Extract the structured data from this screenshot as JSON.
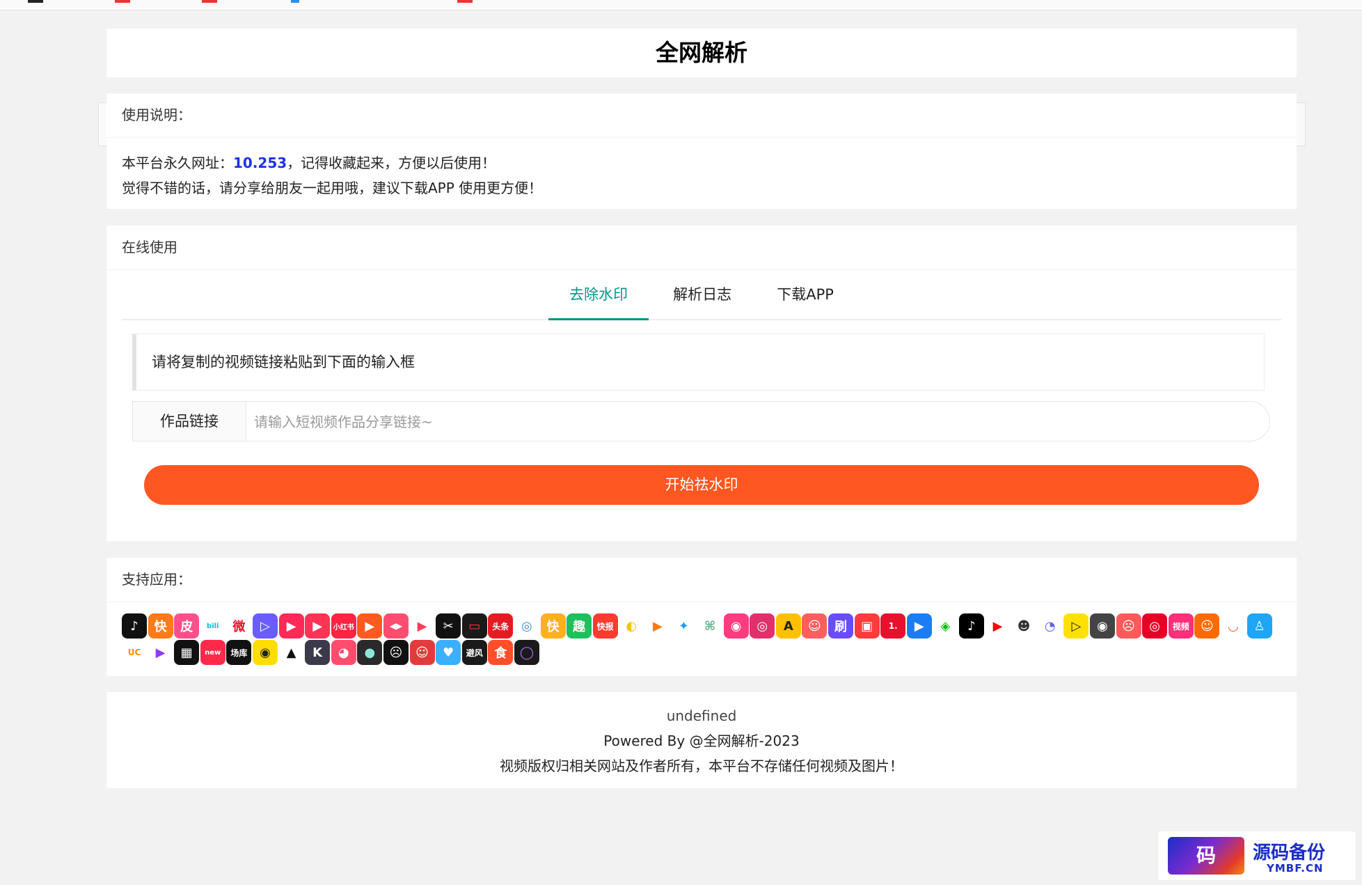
{
  "page": {
    "title": "全网解析"
  },
  "notice": {
    "heading": "使用说明：",
    "line1_prefix": "本平台永久网址：",
    "url": "10.253",
    "line1_suffix": "，记得收藏起来，方便以后使用！",
    "line2": "觉得不错的话，请分享给朋友一起用哦，建议下载APP 使用更方便！"
  },
  "online": {
    "heading": "在线使用",
    "tabs": [
      {
        "label": "去除水印",
        "active": true
      },
      {
        "label": "解析日志",
        "active": false
      },
      {
        "label": "下载APP",
        "active": false
      }
    ],
    "hint": "请将复制的视频链接粘贴到下面的输入框",
    "input_label": "作品链接",
    "input_placeholder": "请输入短视频作品分享链接~",
    "input_value": "",
    "submit_label": "开始祛水印"
  },
  "apps": {
    "heading": "支持应用：",
    "icons": [
      {
        "name": "douyin-icon",
        "text": "♪",
        "bg": "#111111"
      },
      {
        "name": "kuaishou-icon",
        "text": "快",
        "bg": "#ff7a18"
      },
      {
        "name": "pipixia-icon",
        "text": "皮",
        "bg": "#ff4f8b"
      },
      {
        "name": "bilibili-icon",
        "text": "bili",
        "bg": "#ffffff",
        "fg": "#23ade5"
      },
      {
        "name": "weibo-icon",
        "text": "微",
        "bg": "#ffffff",
        "fg": "#e6162d"
      },
      {
        "name": "player-icon",
        "text": "▷",
        "bg": "#6b5cff"
      },
      {
        "name": "live-icon",
        "text": "▶",
        "bg": "#ff2a55"
      },
      {
        "name": "video-icon",
        "text": "▶",
        "bg": "#ff3355"
      },
      {
        "name": "xiaohongshu-icon",
        "text": "小红书",
        "bg": "#ff2442"
      },
      {
        "name": "huoshan-icon",
        "text": "▶",
        "bg": "#ff5a1f"
      },
      {
        "name": "camera-icon",
        "text": "◀▶",
        "bg": "#ff4d6d"
      },
      {
        "name": "play-icon",
        "text": "▶",
        "bg": "#ffffff",
        "fg": "#ff3b5c"
      },
      {
        "name": "capcut-icon",
        "text": "✂",
        "bg": "#111111"
      },
      {
        "name": "xigua-icon",
        "text": "▭",
        "bg": "#1a1a1a",
        "fg": "#ff3b30"
      },
      {
        "name": "toutiao-icon",
        "text": "头条",
        "bg": "#e51b23"
      },
      {
        "name": "lens-icon",
        "text": "◎",
        "bg": "#ffffff",
        "fg": "#3a8ee6"
      },
      {
        "name": "kuai-icon",
        "text": "快",
        "bg": "#ffb020"
      },
      {
        "name": "qu-icon",
        "text": "趣",
        "bg": "#1ec05c"
      },
      {
        "name": "kuaibao-icon",
        "text": "快报",
        "bg": "#ff3b30"
      },
      {
        "name": "bird-icon",
        "text": "◐",
        "bg": "#ffffff",
        "fg": "#f5c400"
      },
      {
        "name": "weishi-icon",
        "text": "▶",
        "bg": "#ffffff",
        "fg": "#ff7a00"
      },
      {
        "name": "twitter-icon",
        "text": "✦",
        "bg": "#ffffff",
        "fg": "#1da1f2"
      },
      {
        "name": "plant-icon",
        "text": "⌘",
        "bg": "#ffffff",
        "fg": "#63b58a"
      },
      {
        "name": "momo-icon",
        "text": "◉",
        "bg": "#ff3c7f"
      },
      {
        "name": "instagram-icon",
        "text": "◎",
        "bg": "#e1306c"
      },
      {
        "name": "acfun-icon",
        "text": "A",
        "bg": "#ffc000",
        "fg": "#222222"
      },
      {
        "name": "face-icon",
        "text": "☺",
        "bg": "#ff5e5e"
      },
      {
        "name": "shua-icon",
        "text": "刷",
        "bg": "#6a4cff"
      },
      {
        "name": "tv-icon",
        "text": "▣",
        "bg": "#ff3b3b"
      },
      {
        "name": "one-icon",
        "text": "1.",
        "bg": "#e8112d"
      },
      {
        "name": "youku-icon",
        "text": "▶",
        "bg": "#1c7cf4"
      },
      {
        "name": "iqiyi-icon",
        "text": "◈",
        "bg": "#ffffff",
        "fg": "#00be06"
      },
      {
        "name": "tiktok-icon",
        "text": "♪",
        "bg": "#000000"
      },
      {
        "name": "youtube-icon",
        "text": "▶",
        "bg": "#ffffff",
        "fg": "#ff0000"
      },
      {
        "name": "cartoon-icon",
        "text": "☻",
        "bg": "#ffffff",
        "fg": "#333333"
      },
      {
        "name": "chat-icon",
        "text": "◔",
        "bg": "#ffffff",
        "fg": "#6a5cff"
      },
      {
        "name": "pear-icon",
        "text": "▷",
        "bg": "#ffe100",
        "fg": "#222222"
      },
      {
        "name": "eye-icon",
        "text": "◉",
        "bg": "#444444"
      },
      {
        "name": "meme-icon",
        "text": "☹",
        "bg": "#ff5a5a"
      },
      {
        "name": "netease-icon",
        "text": "◎",
        "bg": "#e60026"
      },
      {
        "name": "shipin-icon",
        "text": "视频",
        "bg": "#ff2f7a"
      },
      {
        "name": "anime-icon",
        "text": "☺",
        "bg": "#ff6a00"
      },
      {
        "name": "bowl-icon",
        "text": "◡",
        "bg": "#ffffff",
        "fg": "#f25a3b"
      },
      {
        "name": "qq-icon",
        "text": "♙",
        "bg": "#1fa5f5"
      },
      {
        "name": "uc-icon",
        "text": "UC",
        "bg": "#ffffff",
        "fg": "#ff8a00"
      },
      {
        "name": "triangle-icon",
        "text": "▶",
        "bg": "#ffffff",
        "fg": "#8a3bff"
      },
      {
        "name": "stripes-icon",
        "text": "▦",
        "bg": "#111111"
      },
      {
        "name": "new-icon",
        "text": "new",
        "bg": "#ff2a4a"
      },
      {
        "name": "changku-icon",
        "text": "场库",
        "bg": "#111111"
      },
      {
        "name": "dianshi-icon",
        "text": "◉",
        "bg": "#ffdd00",
        "fg": "#222222"
      },
      {
        "name": "bolt-icon",
        "text": "▲",
        "bg": "#ffffff",
        "fg": "#111111"
      },
      {
        "name": "k-icon",
        "text": "K",
        "bg": "#3a3a4a"
      },
      {
        "name": "paint-icon",
        "text": "◕",
        "bg": "#ff4d6d"
      },
      {
        "name": "circle-icon",
        "text": "●",
        "bg": "#2a2a2a",
        "fg": "#8ee6d8"
      },
      {
        "name": "ghost-icon",
        "text": "☹",
        "bg": "#111111"
      },
      {
        "name": "monkey-icon",
        "text": "☺",
        "bg": "#e23b3b"
      },
      {
        "name": "heart-icon",
        "text": "♥",
        "bg": "#3ab0ff"
      },
      {
        "name": "bifeng-icon",
        "text": "避风",
        "bg": "#1a1a1a"
      },
      {
        "name": "shi-icon",
        "text": "食",
        "bg": "#ff4e2a"
      },
      {
        "name": "ring-icon",
        "text": "◯",
        "bg": "#1a1a1a",
        "fg": "#b06cff"
      }
    ]
  },
  "footer": {
    "line1": "undefined",
    "line2": "Powered By @全网解析-2023",
    "line3": "视频版权归相关网站及作者所有，本平台不存储任何视频及图片！"
  },
  "watermark": {
    "logo_char": "码",
    "title": "源码备份",
    "subtitle": "YMBF.CN"
  }
}
